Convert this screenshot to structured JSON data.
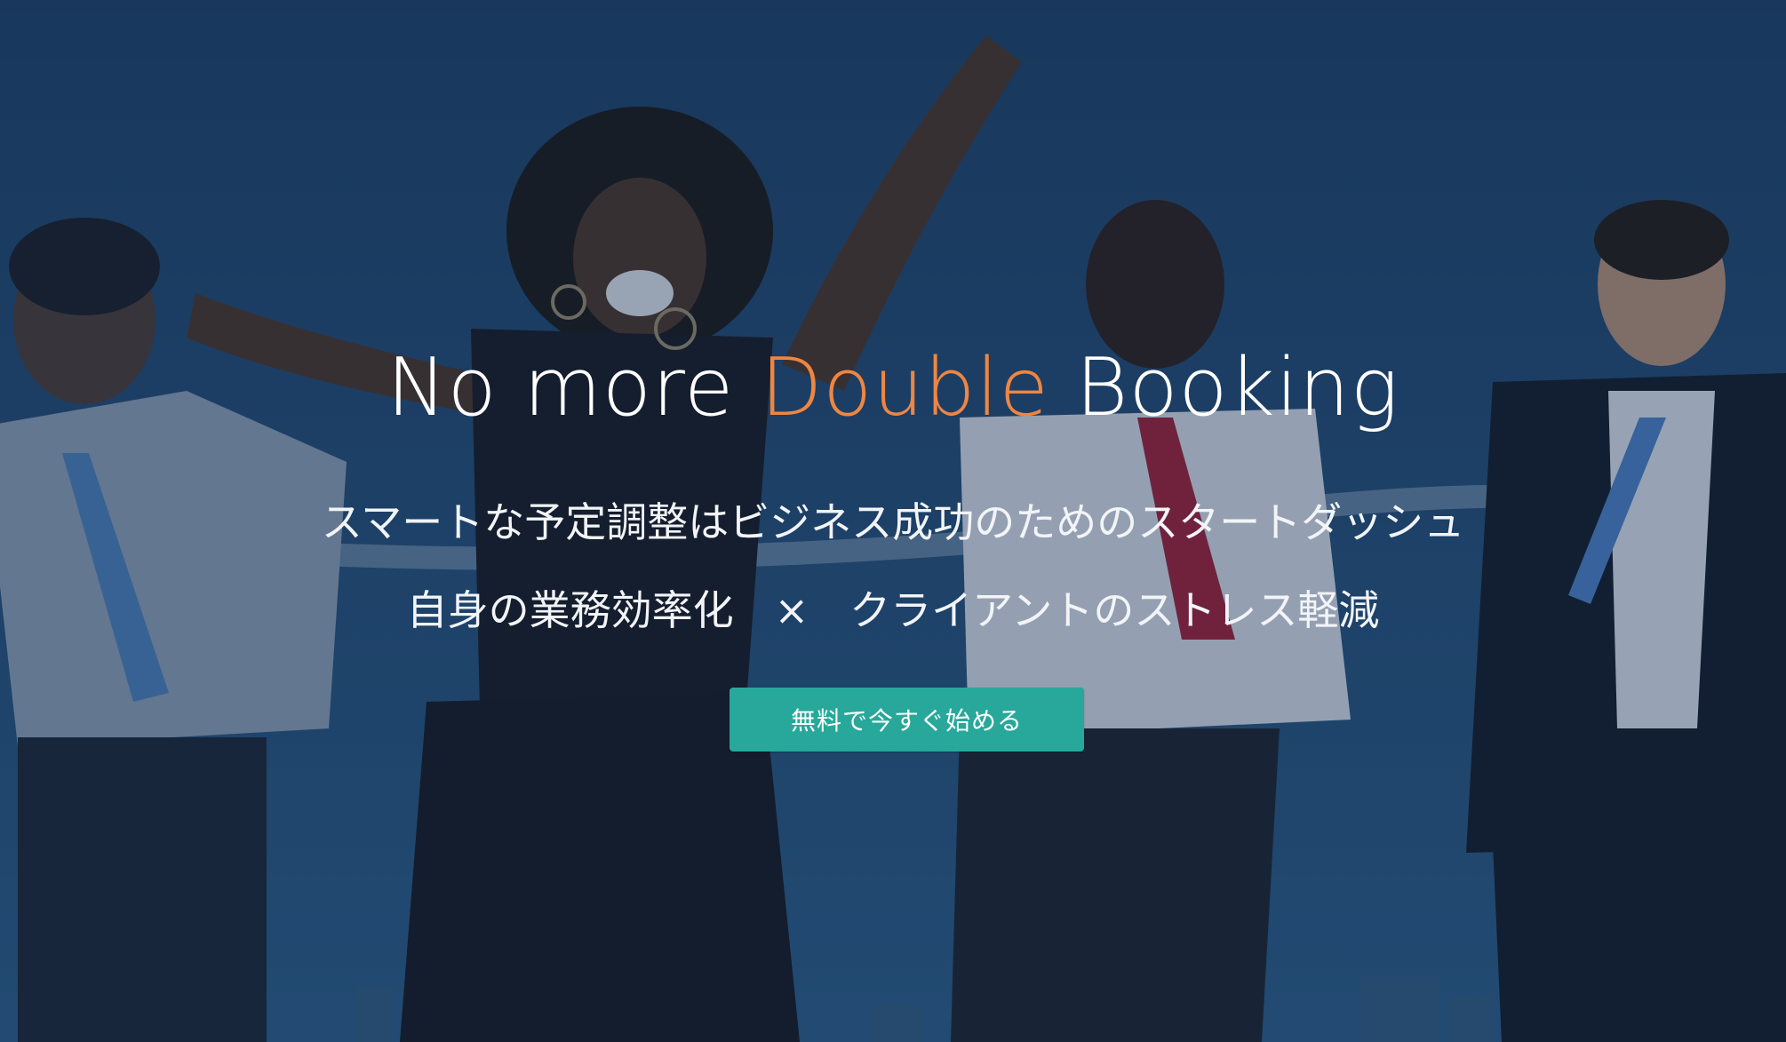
{
  "hero": {
    "headline_prefix": "No more ",
    "headline_accent": "Double",
    "headline_suffix": " Booking",
    "subline_1": "スマートな予定調整はビジネス成功のためのスタートダッシュ",
    "subline_2": "自身の業務効率化　×　クライアントのストレス軽減",
    "cta_label": "無料で今すぐ始める"
  },
  "colors": {
    "accent": "#ee8642",
    "cta_background": "#27a89a",
    "text": "#ffffff",
    "overlay": "#1f466f"
  }
}
